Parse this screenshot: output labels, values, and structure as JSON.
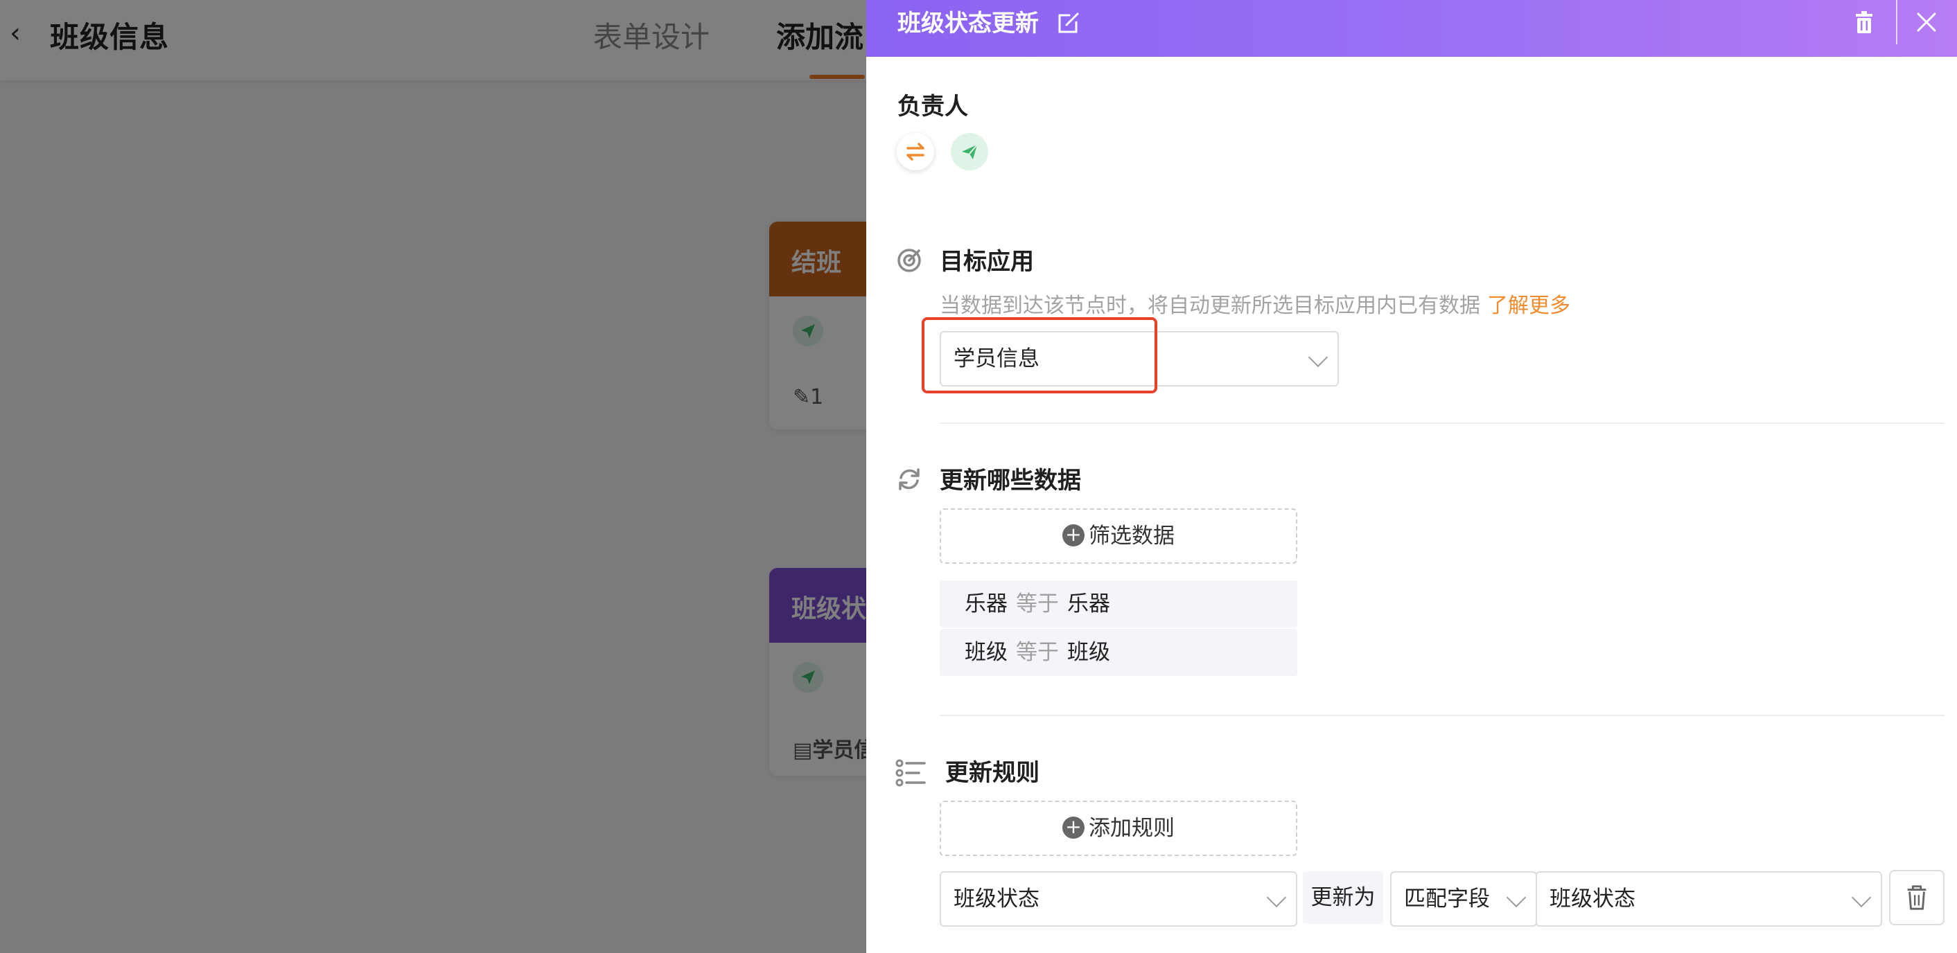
{
  "background": {
    "title": "班级信息",
    "tabs": [
      {
        "label": "表单设计"
      },
      {
        "label": "添加流"
      }
    ],
    "cards": [
      {
        "title": "结班",
        "color": "#c8641f",
        "footer": "1"
      },
      {
        "title": "班级状",
        "color": "#7a4fd1",
        "footer": "学员信"
      }
    ]
  },
  "drawer": {
    "title": "班级状态更新",
    "header_gradient": [
      "#8a63f2",
      "#b77cf4"
    ],
    "assignee": {
      "label": "负责人"
    },
    "target_app": {
      "label": "目标应用",
      "hint": "当数据到达该节点时，将自动更新所选目标应用内已有数据",
      "hint_link": "了解更多",
      "selected": "学员信息",
      "link_color": "#f08c2e",
      "highlight_color": "#e8412c"
    },
    "update_data": {
      "label": "更新哪些数据",
      "filter_button": "筛选数据",
      "conditions": [
        {
          "field": "乐器",
          "op": "等于",
          "value": "乐器"
        },
        {
          "field": "班级",
          "op": "等于",
          "value": "班级"
        }
      ]
    },
    "update_rules": {
      "label": "更新规则",
      "add_button": "添加规则",
      "rule": {
        "field": "班级状态",
        "update_as": "更新为",
        "mode": "匹配字段",
        "source": "班级状态"
      }
    }
  }
}
